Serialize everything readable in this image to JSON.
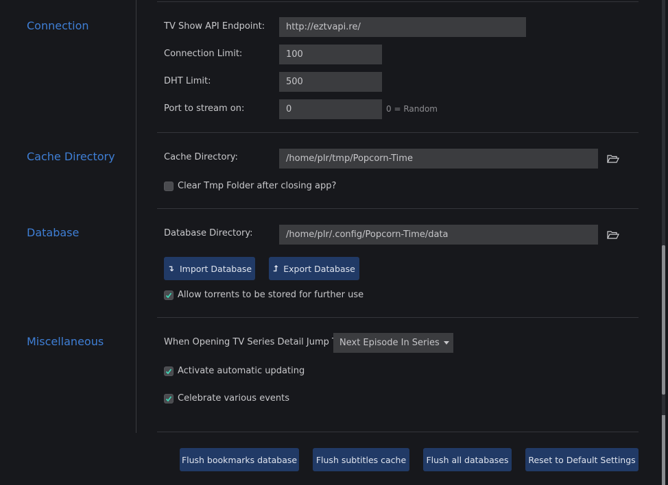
{
  "sections": {
    "connection": {
      "title": "Connection",
      "tv_api_label": "TV Show API Endpoint:",
      "tv_api_value": "http://eztvapi.re/",
      "conn_limit_label": "Connection Limit:",
      "conn_limit_value": "100",
      "dht_limit_label": "DHT Limit:",
      "dht_limit_value": "500",
      "port_label": "Port to stream on:",
      "port_value": "0",
      "port_hint": "0 = Random"
    },
    "cache": {
      "title": "Cache Directory",
      "dir_label": "Cache Directory:",
      "dir_value": "/home/plr/tmp/Popcorn-Time",
      "clear_tmp_label": "Clear Tmp Folder after closing app?",
      "clear_tmp_checked": false
    },
    "database": {
      "title": "Database",
      "dir_label": "Database Directory:",
      "dir_value": "/home/plr/.config/Popcorn-Time/data",
      "import_label": "Import Database",
      "export_label": "Export Database",
      "allow_torrents_label": "Allow torrents to be stored for further use",
      "allow_torrents_checked": true
    },
    "misc": {
      "title": "Miscellaneous",
      "jump_label": "When Opening TV Series Detail Jump To:",
      "jump_value": "Next Episode In Series",
      "auto_update_label": "Activate automatic updating",
      "auto_update_checked": true,
      "celebrate_label": "Celebrate various events",
      "celebrate_checked": true
    }
  },
  "footer": {
    "flush_bookmarks": "Flush bookmarks database",
    "flush_subtitles": "Flush subtitles cache",
    "flush_all": "Flush all databases",
    "reset": "Reset to Default Settings"
  },
  "colors": {
    "accent": "#3f7fd6",
    "button_bg": "#213a66",
    "check": "#3fd6b5"
  }
}
